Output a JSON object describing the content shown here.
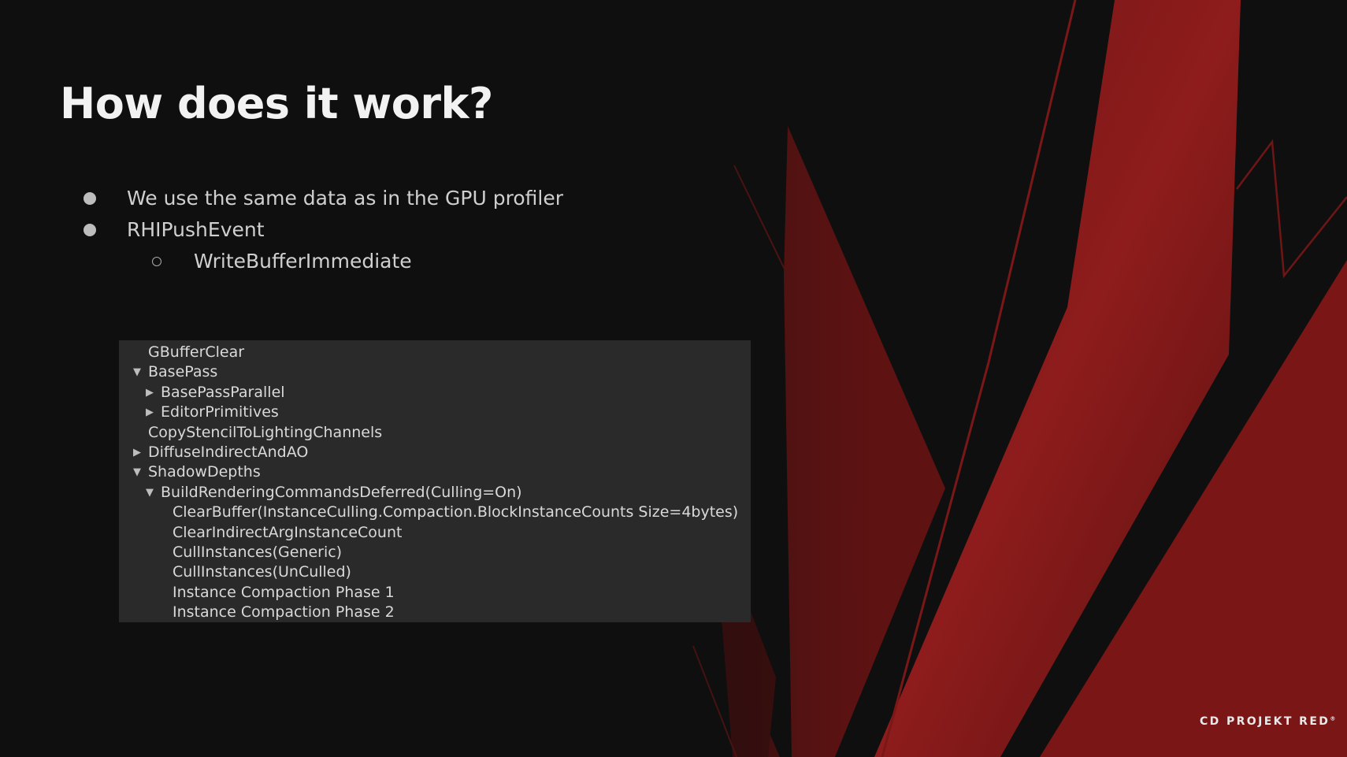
{
  "slide": {
    "title": "How does it work?",
    "bullets": [
      "We use the same data as in the GPU profiler",
      "RHIPushEvent"
    ],
    "sub_bullets": [
      "WriteBufferImmediate"
    ]
  },
  "event_tree": {
    "rows": [
      {
        "label": "GBufferClear"
      },
      {
        "label": "BasePass",
        "state": "expanded"
      },
      {
        "label": "BasePassParallel",
        "state": "collapsed"
      },
      {
        "label": "EditorPrimitives",
        "state": "collapsed"
      },
      {
        "label": "CopyStencilToLightingChannels"
      },
      {
        "label": "DiffuseIndirectAndAO",
        "state": "collapsed"
      },
      {
        "label": "ShadowDepths",
        "state": "expanded"
      },
      {
        "label": "BuildRenderingCommandsDeferred(Culling=On)",
        "state": "expanded"
      },
      {
        "label": "ClearBuffer(InstanceCulling.Compaction.BlockInstanceCounts Size=4bytes)"
      },
      {
        "label": "ClearIndirectArgInstanceCount"
      },
      {
        "label": "CullInstances(Generic)"
      },
      {
        "label": "CullInstances(UnCulled)"
      },
      {
        "label": "Instance Compaction Phase 1"
      },
      {
        "label": "Instance Compaction Phase 2"
      }
    ]
  },
  "logo": {
    "text": "CD PROJEKT RED",
    "mark": "®"
  },
  "colors": {
    "background": "#0f0f0f",
    "accent_red": "#8e1a1a",
    "panel": "#2a2a2a"
  },
  "icons": {
    "expanded": "triangle-down-icon",
    "collapsed": "triangle-right-icon"
  }
}
